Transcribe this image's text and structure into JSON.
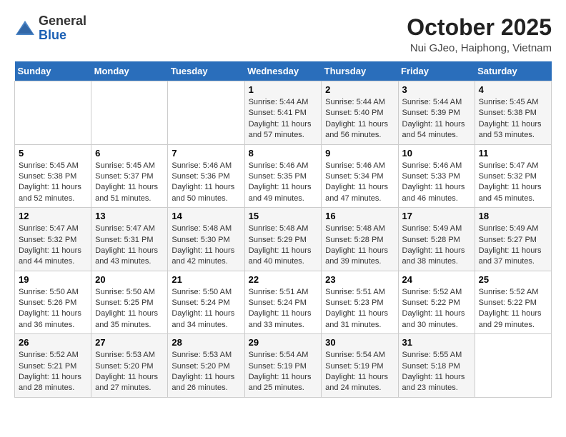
{
  "header": {
    "logo_general": "General",
    "logo_blue": "Blue",
    "month_title": "October 2025",
    "location": "Nui GJeo, Haiphong, Vietnam"
  },
  "weekdays": [
    "Sunday",
    "Monday",
    "Tuesday",
    "Wednesday",
    "Thursday",
    "Friday",
    "Saturday"
  ],
  "weeks": [
    [
      {
        "day": "",
        "info": ""
      },
      {
        "day": "",
        "info": ""
      },
      {
        "day": "",
        "info": ""
      },
      {
        "day": "1",
        "info": "Sunrise: 5:44 AM\nSunset: 5:41 PM\nDaylight: 11 hours and 57 minutes."
      },
      {
        "day": "2",
        "info": "Sunrise: 5:44 AM\nSunset: 5:40 PM\nDaylight: 11 hours and 56 minutes."
      },
      {
        "day": "3",
        "info": "Sunrise: 5:44 AM\nSunset: 5:39 PM\nDaylight: 11 hours and 54 minutes."
      },
      {
        "day": "4",
        "info": "Sunrise: 5:45 AM\nSunset: 5:38 PM\nDaylight: 11 hours and 53 minutes."
      }
    ],
    [
      {
        "day": "5",
        "info": "Sunrise: 5:45 AM\nSunset: 5:38 PM\nDaylight: 11 hours and 52 minutes."
      },
      {
        "day": "6",
        "info": "Sunrise: 5:45 AM\nSunset: 5:37 PM\nDaylight: 11 hours and 51 minutes."
      },
      {
        "day": "7",
        "info": "Sunrise: 5:46 AM\nSunset: 5:36 PM\nDaylight: 11 hours and 50 minutes."
      },
      {
        "day": "8",
        "info": "Sunrise: 5:46 AM\nSunset: 5:35 PM\nDaylight: 11 hours and 49 minutes."
      },
      {
        "day": "9",
        "info": "Sunrise: 5:46 AM\nSunset: 5:34 PM\nDaylight: 11 hours and 47 minutes."
      },
      {
        "day": "10",
        "info": "Sunrise: 5:46 AM\nSunset: 5:33 PM\nDaylight: 11 hours and 46 minutes."
      },
      {
        "day": "11",
        "info": "Sunrise: 5:47 AM\nSunset: 5:32 PM\nDaylight: 11 hours and 45 minutes."
      }
    ],
    [
      {
        "day": "12",
        "info": "Sunrise: 5:47 AM\nSunset: 5:32 PM\nDaylight: 11 hours and 44 minutes."
      },
      {
        "day": "13",
        "info": "Sunrise: 5:47 AM\nSunset: 5:31 PM\nDaylight: 11 hours and 43 minutes."
      },
      {
        "day": "14",
        "info": "Sunrise: 5:48 AM\nSunset: 5:30 PM\nDaylight: 11 hours and 42 minutes."
      },
      {
        "day": "15",
        "info": "Sunrise: 5:48 AM\nSunset: 5:29 PM\nDaylight: 11 hours and 40 minutes."
      },
      {
        "day": "16",
        "info": "Sunrise: 5:48 AM\nSunset: 5:28 PM\nDaylight: 11 hours and 39 minutes."
      },
      {
        "day": "17",
        "info": "Sunrise: 5:49 AM\nSunset: 5:28 PM\nDaylight: 11 hours and 38 minutes."
      },
      {
        "day": "18",
        "info": "Sunrise: 5:49 AM\nSunset: 5:27 PM\nDaylight: 11 hours and 37 minutes."
      }
    ],
    [
      {
        "day": "19",
        "info": "Sunrise: 5:50 AM\nSunset: 5:26 PM\nDaylight: 11 hours and 36 minutes."
      },
      {
        "day": "20",
        "info": "Sunrise: 5:50 AM\nSunset: 5:25 PM\nDaylight: 11 hours and 35 minutes."
      },
      {
        "day": "21",
        "info": "Sunrise: 5:50 AM\nSunset: 5:24 PM\nDaylight: 11 hours and 34 minutes."
      },
      {
        "day": "22",
        "info": "Sunrise: 5:51 AM\nSunset: 5:24 PM\nDaylight: 11 hours and 33 minutes."
      },
      {
        "day": "23",
        "info": "Sunrise: 5:51 AM\nSunset: 5:23 PM\nDaylight: 11 hours and 31 minutes."
      },
      {
        "day": "24",
        "info": "Sunrise: 5:52 AM\nSunset: 5:22 PM\nDaylight: 11 hours and 30 minutes."
      },
      {
        "day": "25",
        "info": "Sunrise: 5:52 AM\nSunset: 5:22 PM\nDaylight: 11 hours and 29 minutes."
      }
    ],
    [
      {
        "day": "26",
        "info": "Sunrise: 5:52 AM\nSunset: 5:21 PM\nDaylight: 11 hours and 28 minutes."
      },
      {
        "day": "27",
        "info": "Sunrise: 5:53 AM\nSunset: 5:20 PM\nDaylight: 11 hours and 27 minutes."
      },
      {
        "day": "28",
        "info": "Sunrise: 5:53 AM\nSunset: 5:20 PM\nDaylight: 11 hours and 26 minutes."
      },
      {
        "day": "29",
        "info": "Sunrise: 5:54 AM\nSunset: 5:19 PM\nDaylight: 11 hours and 25 minutes."
      },
      {
        "day": "30",
        "info": "Sunrise: 5:54 AM\nSunset: 5:19 PM\nDaylight: 11 hours and 24 minutes."
      },
      {
        "day": "31",
        "info": "Sunrise: 5:55 AM\nSunset: 5:18 PM\nDaylight: 11 hours and 23 minutes."
      },
      {
        "day": "",
        "info": ""
      }
    ]
  ]
}
